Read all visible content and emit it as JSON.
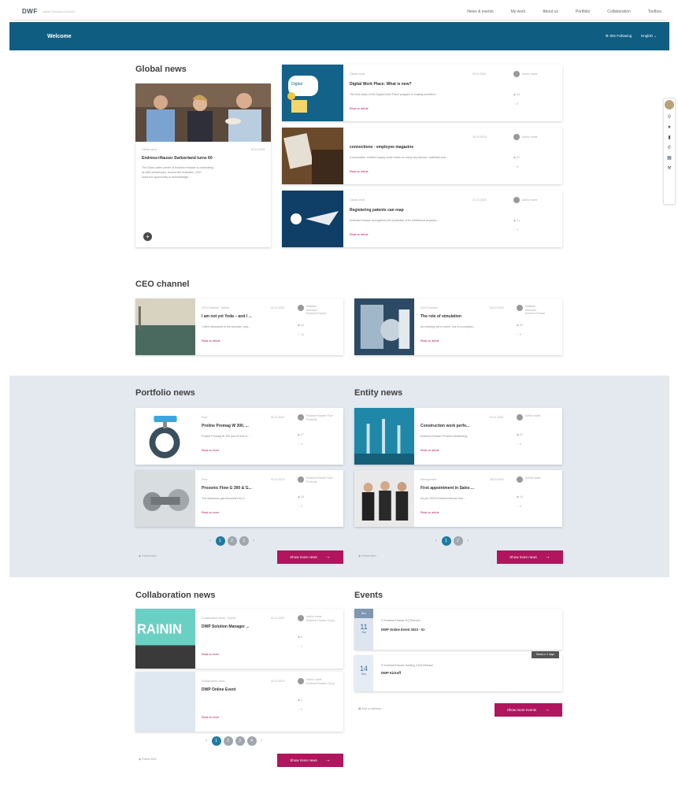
{
  "topbar": {
    "logo": "DWF",
    "subtitle": "Inside Endress+Hauser",
    "nav": [
      "News & events",
      "My work",
      "About us",
      "Portfolio",
      "Collaboration",
      "Toolbox"
    ]
  },
  "banner": {
    "title": "Welcome",
    "links": [
      "⚙ Site Following",
      "English ⌄"
    ]
  },
  "colors": {
    "primary": "#0f5e82",
    "accent": "#b0155d",
    "band": "#e4e9f0"
  },
  "global_news": {
    "title": "Global news",
    "featured": {
      "meta_left": "Global news",
      "meta_right": "03.11.2023",
      "title": "Endress+Hauser Switzerland turns 60",
      "excerpt": [
        "The Swiss sales center of Endress+Hauser is celebrating",
        "its 60th anniversary. Around the festivities, CEO",
        "looks the opportunity to acknowledge..."
      ]
    },
    "items": [
      {
        "meta_left": "Global news",
        "meta_right": "02.11.2023",
        "author": "Author name",
        "title": "Digital Work Place: What is new?",
        "excerpt": "The first steps of the Digital Work Place program is making excellent...",
        "link": "Read on article",
        "views": "44",
        "likes": "8"
      },
      {
        "meta_left": "",
        "meta_right": "30.10.2023",
        "author": "Author name",
        "title": "connections - employee magazine",
        "excerpt": "A successful, resilient supply chain relies on many key factors: materials and...",
        "link": "Read on article",
        "views": "32",
        "likes": "5"
      },
      {
        "meta_left": "Global news",
        "meta_right": "27.10.2023",
        "author": "Author name",
        "title": "Registering patents can reap",
        "excerpt": "Endress+Hauser strengthens the protection of its intellectual property...",
        "link": "Read on article",
        "views": "21",
        "likes": "3"
      }
    ]
  },
  "ceo": {
    "title": "CEO channel",
    "items": [
      {
        "meta_left": "CEO Channel · Global",
        "meta_right": "02.11.2023",
        "title": "I am not yet Yoda – and I ...",
        "excerpt": "I often discussed in the promise, only...",
        "link": "Read on article",
        "author": [
          "Matthias",
          "Altendorf",
          "Endress+Hauser"
        ],
        "views": "64",
        "likes": "12"
      },
      {
        "meta_left": "CEO Channel",
        "meta_right": "30.10.2023",
        "title": "The role of simulation",
        "excerpt": "An existing, yet to solve, one in a complex...",
        "link": "Read on article",
        "author": [
          "Matthias",
          "Altendorf",
          "Endress+Hauser"
        ],
        "views": "48",
        "likes": "9"
      }
    ]
  },
  "portfolio": {
    "title": "Portfolio news",
    "followers": "Follow feed",
    "button": "Show more news",
    "items": [
      {
        "meta_left": "Flow",
        "meta_right": "02.11.2023",
        "title": "Proline Promag W 300, ...",
        "excerpt": "Proline Promag W 300 and W 400 is...",
        "link": "Read on more",
        "author": [
          "Endress+Hauser Flow",
          "Products"
        ],
        "views": "17",
        "likes": "4"
      },
      {
        "meta_left": "Flow",
        "meta_right": "31.10.2023",
        "title": "Prosonic Flow G 300 & G...",
        "excerpt": "The ultrasonic gas flowmeter for h...",
        "link": "Read on more",
        "author": [
          "Endress+Hauser Flow",
          "Products"
        ],
        "views": "15",
        "likes": "2"
      }
    ],
    "pages": [
      "1",
      "2",
      "3"
    ]
  },
  "entity": {
    "title": "Entity news",
    "followers": "Follow feed",
    "button": "Show more news",
    "items": [
      {
        "meta_left": "",
        "meta_right": "01.11.2023",
        "title": "Construction work perfo...",
        "excerpt": "Endress+Hauser Process Measuring...",
        "link": "Read on article",
        "author": [
          "Author name"
        ],
        "views": "22",
        "likes": "6"
      },
      {
        "meta_left": "Management",
        "meta_right": "28.10.2023",
        "title": "First appointment in Sales ...",
        "excerpt": "As per 2024 Endress+Hauser has...",
        "link": "Read on article",
        "author": [
          "Author name"
        ],
        "views": "19",
        "likes": "3"
      }
    ],
    "pages": [
      "1",
      "2"
    ]
  },
  "collab": {
    "title": "Collaboration news",
    "followers": "Follow feed",
    "button": "Show more news",
    "items": [
      {
        "meta_left": "Collaboration news · Global",
        "meta_right": "02.11.2023",
        "title": "DWP Solution Manager ...",
        "link": "Read on more",
        "author": [
          "Author name",
          "Endress+Hauser Group"
        ],
        "views": "6",
        "likes": "1",
        "img_text": "RAININ"
      },
      {
        "meta_left": "Collaboration news",
        "meta_right": "30.10.2023",
        "title": "DWP Online Event",
        "link": "Read on more",
        "author": [
          "Author name",
          "Endress+Hauser Group"
        ],
        "views": "4",
        "likes": "0",
        "img_text": ""
      }
    ],
    "pages": [
      "1",
      "2",
      "3",
      "4"
    ]
  },
  "events": {
    "title": "Events",
    "followers": "Add to calendar",
    "button": "Show more events",
    "items": [
      {
        "month": "Nov",
        "day": "11",
        "sub": "Sat",
        "location": "Endress+Hauser HQ Reinach",
        "title": "DWP Online Event 2023 - 01",
        "badge": ""
      },
      {
        "month": "",
        "day": "14",
        "sub": "Nov",
        "location": "Endress+Hauser Holding, 4153 Reinach",
        "title": "DWP Kickoff",
        "badge": "Starts in 3 days"
      }
    ]
  }
}
